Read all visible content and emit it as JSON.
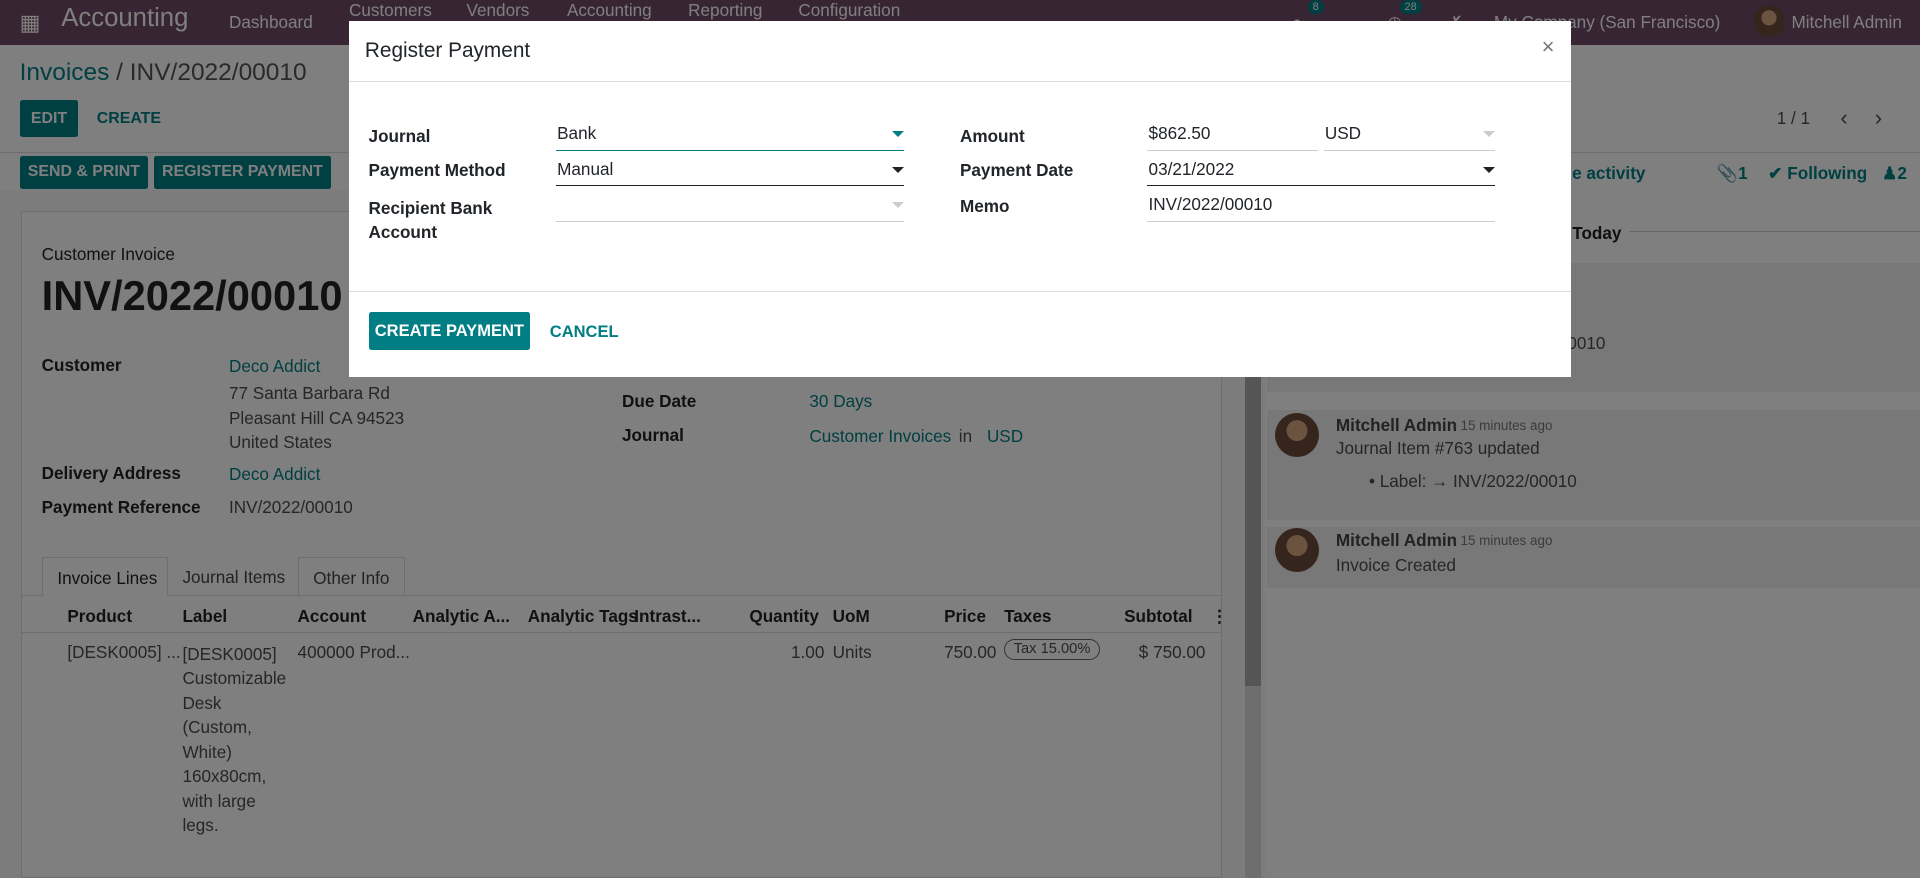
{
  "navbar": {
    "app_name": "Accounting",
    "menu": [
      "Dashboard",
      "Customers",
      "Vendors",
      "Accounting",
      "Reporting",
      "Configuration"
    ],
    "messages_count": "8",
    "activities_count": "28",
    "company": "My Company (San Francisco)",
    "user": "Mitchell Admin"
  },
  "breadcrumb": {
    "parent": "Invoices",
    "separator": " / ",
    "current": "INV/2022/00010"
  },
  "control": {
    "edit": "EDIT",
    "create": "CREATE",
    "pager": "1 / 1"
  },
  "status_buttons": {
    "send_print": "SEND & PRINT",
    "register_payment": "REGISTER PAYMENT"
  },
  "chatter_header": {
    "schedule_activity": "le activity",
    "attachments": "1",
    "following": "Following",
    "followers": "2"
  },
  "form": {
    "type": "Customer Invoice",
    "number": "INV/2022/00010",
    "customer_label": "Customer",
    "customer": "Deco Addict",
    "address": [
      "77 Santa Barbara Rd",
      "Pleasant Hill CA 94523",
      "United States"
    ],
    "delivery_label": "Delivery Address",
    "delivery": "Deco Addict",
    "payref_label": "Payment Reference",
    "payref": "INV/2022/00010",
    "due_label": "Due Date",
    "due": "30 Days",
    "journal_label": "Journal",
    "journal": "Customer Invoices",
    "in": "in",
    "currency": "USD"
  },
  "tabs": [
    "Invoice Lines",
    "Journal Items",
    "Other Info"
  ],
  "table": {
    "headers": [
      "Product",
      "Label",
      "Account",
      "Analytic A...",
      "Analytic Tags",
      "Intrast...",
      "Quantity",
      "UoM",
      "Price",
      "Taxes",
      "Subtotal"
    ],
    "rows": [
      {
        "product": "[DESK0005] ...",
        "label": [
          "[DESK0005]",
          "Customizable",
          "Desk",
          "(Custom,",
          "White)",
          "160x80cm,",
          "with large",
          "legs."
        ],
        "account": "400000 Prod...",
        "quantity": "1.00",
        "uom": "Units",
        "price": "750.00",
        "tax": "Tax 15.00%",
        "subtotal": "$ 750.00"
      }
    ]
  },
  "chatter": {
    "today": "Today",
    "partial_text": "0010",
    "messages": [
      {
        "author": "Mitchell Admin",
        "time": "- 15 minutes ago",
        "body": "Journal Item #763 updated",
        "change": "Label: → INV/2022/00010"
      },
      {
        "author": "Mitchell Admin",
        "time": "- 15 minutes ago",
        "body": "Invoice Created"
      }
    ]
  },
  "modal": {
    "title": "Register Payment",
    "close": "×",
    "journal_label": "Journal",
    "journal": "Bank",
    "method_label": "Payment Method",
    "method": "Manual",
    "recipient_label": "Recipient Bank Account",
    "recipient": "",
    "amount_label": "Amount",
    "amount": "$862.50",
    "currency": "USD",
    "date_label": "Payment Date",
    "date": "03/21/2022",
    "memo_label": "Memo",
    "memo": "INV/2022/00010",
    "create": "CREATE PAYMENT",
    "cancel": "CANCEL"
  },
  "colors": {
    "brand": "#714B67",
    "accent": "#017e84"
  }
}
